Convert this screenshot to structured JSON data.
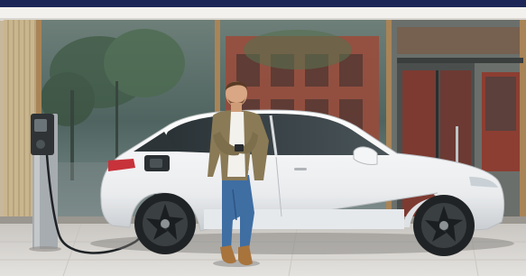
{
  "image": {
    "scene_name": "electric-car-charging-scene",
    "colors": {
      "top_bar": "#1d2757",
      "car_body": "#eef0f2",
      "glass": "#5b6f6a",
      "building_frame": "#9a7b55",
      "pavement": "#d9d6d2",
      "brick": "#b0523e",
      "charger": "#9aa0a6",
      "jacket": "#8a7a56",
      "jeans": "#3f6ea3"
    }
  }
}
